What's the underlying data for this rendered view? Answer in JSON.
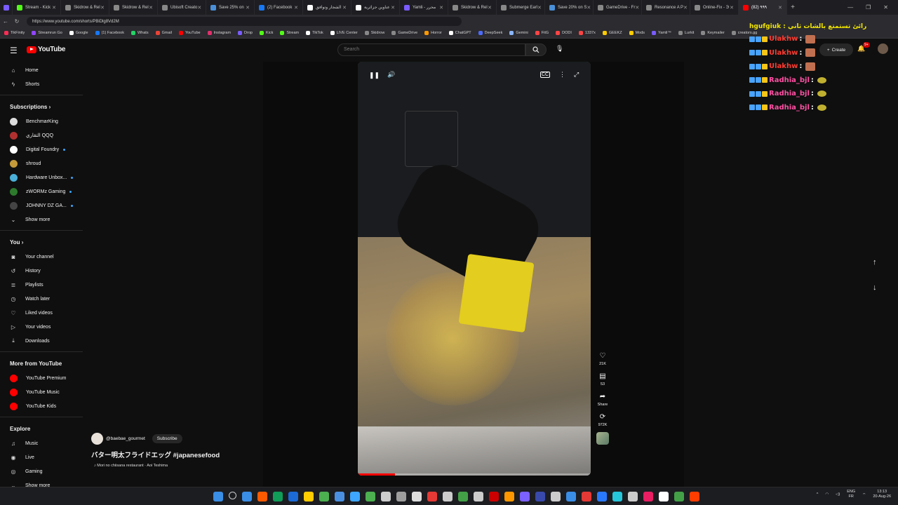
{
  "browser": {
    "tabs": [
      {
        "label": "Stream - Kick",
        "color": "#53fc18"
      },
      {
        "label": "Skidrow & Rel",
        "color": "#888888"
      },
      {
        "label": "Skidrow & Rel",
        "color": "#888888"
      },
      {
        "label": "Ubisoft Creato",
        "color": "#888888"
      },
      {
        "label": "Save 25% on",
        "color": "#4a90d9"
      },
      {
        "label": "(2) Facebook",
        "color": "#1877f2"
      },
      {
        "label": "الشجار وتوافق",
        "color": "#ffffff"
      },
      {
        "label": "عناوين جزائرية",
        "color": "#ffffff"
      },
      {
        "label": "Yamli - محرر",
        "color": "#7a5cff"
      },
      {
        "label": "Skidrow & Rel",
        "color": "#888888"
      },
      {
        "label": "Submerge Earl",
        "color": "#888888"
      },
      {
        "label": "Save 20% on S",
        "color": "#4a90d9"
      },
      {
        "label": "GameDrive - Fr",
        "color": "#888888"
      },
      {
        "label": "Resonance A P",
        "color": "#888888"
      },
      {
        "label": "Online-Fix - Э",
        "color": "#888888"
      },
      {
        "label": "(82) ٩٩٩",
        "color": "#ff0000"
      }
    ],
    "active_tab_index": 15,
    "url": "https://www.youtube.com/shorts/PBiDlg8Vd2M",
    "bookmarks": [
      {
        "label": "TikFinity",
        "color": "#ff2d55"
      },
      {
        "label": "Streamrun Go",
        "color": "#9146ff"
      },
      {
        "label": "Google",
        "color": "#ffffff"
      },
      {
        "label": "(1) Facebook",
        "color": "#1877f2"
      },
      {
        "label": "Whats",
        "color": "#25d366"
      },
      {
        "label": "Gmail",
        "color": "#ea4335"
      },
      {
        "label": "YouTube",
        "color": "#ff0000"
      },
      {
        "label": "Instagram",
        "color": "#e1306c"
      },
      {
        "label": "Drop",
        "color": "#7a5cff"
      },
      {
        "label": "Kick",
        "color": "#53fc18"
      },
      {
        "label": "Stream",
        "color": "#53fc18"
      },
      {
        "label": "TikTok",
        "color": "#ffffff"
      },
      {
        "label": "LIVE Center",
        "color": "#ffffff"
      },
      {
        "label": "Skidrow",
        "color": "#888888"
      },
      {
        "label": "GameDrive",
        "color": "#888888"
      },
      {
        "label": "Horror",
        "color": "#ff9900"
      },
      {
        "label": "ChatGPT",
        "color": "#ffffff"
      },
      {
        "label": "DeepSeek",
        "color": "#4d6bfe"
      },
      {
        "label": "Gemini",
        "color": "#8ab4f8"
      },
      {
        "label": "FitG",
        "color": "#ff4444"
      },
      {
        "label": "DODI",
        "color": "#ff4444"
      },
      {
        "label": "1337x",
        "color": "#ff4444"
      },
      {
        "label": "GEEKZ",
        "color": "#ffcc00"
      },
      {
        "label": "Mods",
        "color": "#ffcc00"
      },
      {
        "label": "Yamli™",
        "color": "#7a5cff"
      },
      {
        "label": "Lurkit",
        "color": "#888888"
      },
      {
        "label": "Keymailer",
        "color": "#888888"
      },
      {
        "label": "creators.gg",
        "color": "#888888"
      }
    ]
  },
  "header": {
    "logo_text": "YouTube",
    "search_placeholder": "Search",
    "create_label": "Create",
    "notif_count": "9+"
  },
  "sidebar": {
    "main": [
      {
        "label": "Home",
        "icon": "⌂",
        "name": "home-icon"
      },
      {
        "label": "Shorts",
        "icon": "ϟ",
        "name": "shorts-icon"
      }
    ],
    "subscriptions_title": "Subscriptions",
    "subscriptions": [
      {
        "label": "BenchmarKing",
        "color": "#dddddd",
        "live": false
      },
      {
        "label": "التقاري QQQ",
        "color": "#b03030",
        "live": false
      },
      {
        "label": "Digital Foundry",
        "color": "#ffffff",
        "live": true
      },
      {
        "label": "shroud",
        "color": "#c49a3a",
        "live": false
      },
      {
        "label": "Hardware Unbox...",
        "color": "#4ab0d9",
        "live": true
      },
      {
        "label": "zWORMz Gaming",
        "color": "#2d7a2d",
        "live": true
      },
      {
        "label": "JOHNNY DZ GA...",
        "color": "#444444",
        "live": true
      }
    ],
    "subs_show_more": "Show more",
    "you_title": "You",
    "you": [
      {
        "label": "Your channel",
        "icon": "◙",
        "name": "your-channel-icon"
      },
      {
        "label": "History",
        "icon": "↺",
        "name": "history-icon"
      },
      {
        "label": "Playlists",
        "icon": "≣",
        "name": "playlists-icon"
      },
      {
        "label": "Watch later",
        "icon": "◷",
        "name": "watch-later-icon"
      },
      {
        "label": "Liked videos",
        "icon": "♡",
        "name": "liked-icon"
      },
      {
        "label": "Your videos",
        "icon": "▷",
        "name": "your-videos-icon"
      },
      {
        "label": "Downloads",
        "icon": "⤓",
        "name": "downloads-icon"
      }
    ],
    "more_title": "More from YouTube",
    "more": [
      {
        "label": "YouTube Premium",
        "color": "#ff0000"
      },
      {
        "label": "YouTube Music",
        "color": "#ff0000"
      },
      {
        "label": "YouTube Kids",
        "color": "#ff0000"
      }
    ],
    "explore_title": "Explore",
    "explore": [
      {
        "label": "Music",
        "icon": "♫",
        "name": "music-icon"
      },
      {
        "label": "Live",
        "icon": "◉",
        "name": "live-icon"
      },
      {
        "label": "Gaming",
        "icon": "◎",
        "name": "gaming-icon"
      }
    ],
    "explore_show_more": "Show more"
  },
  "short": {
    "channel": "@baebae_gourmet",
    "subscribe_label": "Subscribe",
    "title": "バター明太フライドエッグ #japanesefood",
    "sound": "♪ Mori no chiisana restaurant · Aoi Teshima",
    "progress": 0.16,
    "likes": "21K",
    "comments": "53",
    "share_label": "Share",
    "remix_count": "972K"
  },
  "chat": {
    "overlay_text": "hgufgiuk : رائئ تستمتع بالشات ثاني",
    "messages": [
      {
        "user": "Ulakhw",
        "color": "#ff3b30",
        "sep": " :",
        "emote": "#c07050",
        "round": false
      },
      {
        "user": "Ulakhw",
        "color": "#ff3b30",
        "sep": " :",
        "emote": "#c07050",
        "round": false
      },
      {
        "user": "Ulakhw",
        "color": "#ff3b30",
        "sep": " :",
        "emote": "#c07050",
        "round": false
      },
      {
        "user": "Radhia_bjl",
        "color": "#ff4fa3",
        "sep": " :",
        "emote": "#c0b030",
        "round": true
      },
      {
        "user": "Radhia_bjl",
        "color": "#ff4fa3",
        "sep": " :",
        "emote": "#c0b030",
        "round": true
      },
      {
        "user": "Radhia_bjl",
        "color": "#ff4fa3",
        "sep": " :",
        "emote": "#c0b030",
        "round": true
      }
    ]
  },
  "taskbar": {
    "icon_colors": [
      "#3a8ee6",
      "#cccccc",
      "#3a8ee6",
      "#ff5a00",
      "#0f9d58",
      "#1b6ad6",
      "#ffcc00",
      "#4caf50",
      "#4a90e2",
      "#3ea6ff",
      "#4caf50",
      "#cccccc",
      "#9e9e9e",
      "#dddddd",
      "#e53935",
      "#cccccc",
      "#43a047",
      "#cccccc",
      "#cc0000",
      "#ff9800",
      "#7b61ff",
      "#3949ab",
      "#cccccc",
      "#3a8ee6",
      "#e53935",
      "#2979ff",
      "#26c6da",
      "#cccccc",
      "#e91e63",
      "#ffffff",
      "#43a047",
      "#ff3d00"
    ],
    "lang": "ENG",
    "lang_sub": "FR",
    "time": "13:13",
    "date": "20-Aug-26"
  }
}
